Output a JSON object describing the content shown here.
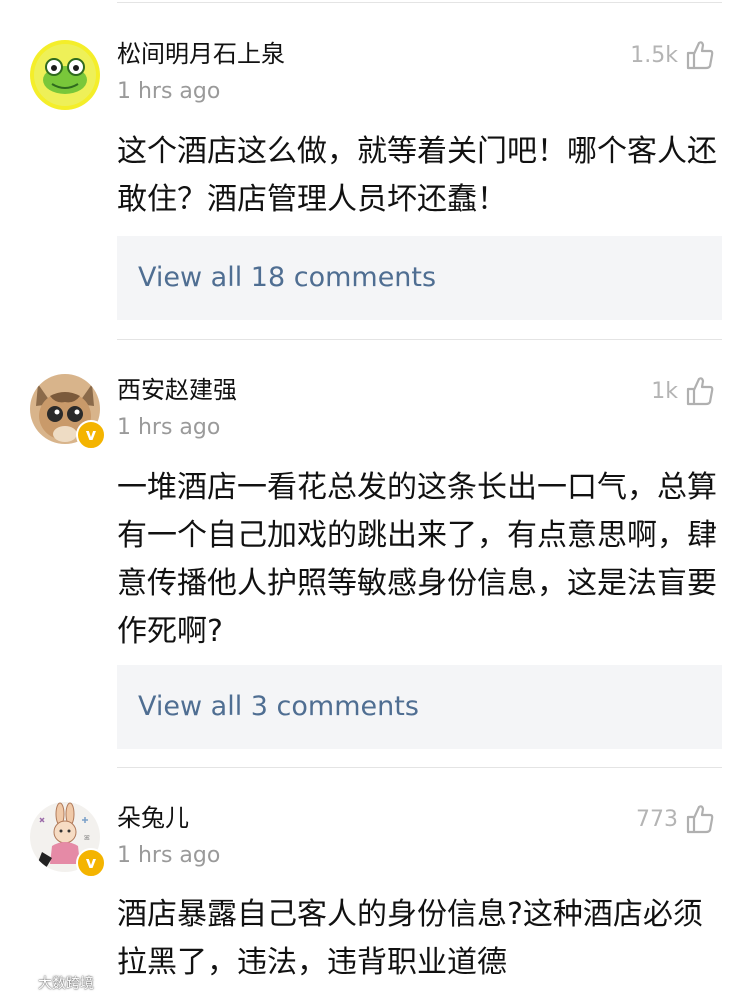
{
  "comments": [
    {
      "username": "松间明月石上泉",
      "time": "1 hrs ago",
      "likes": "1.5k",
      "text": "这个酒店这么做，就等着关门吧！哪个客人还敢住？酒店管理人员坏还蠢！",
      "replies_label": "View all 18 comments",
      "verified": false,
      "avatar": "green-frog-avatar"
    },
    {
      "username": "西安赵建强",
      "time": "1 hrs ago",
      "likes": "1k",
      "text": "一堆酒店一看花总发的这条长出一口气，总算有一个自己加戏的跳出来了，有点意思啊，肆意传播他人护照等敏感身份信息，这是法盲要作死啊?",
      "replies_label": "View all 3 comments",
      "verified": true,
      "avatar": "cat-avatar"
    },
    {
      "username": "朵兔儿",
      "time": "1 hrs ago",
      "likes": "773",
      "text": "酒店暴露自己客人的身份信息?这种酒店必须拉黑了，违法，违背职业道德",
      "verified": true,
      "avatar": "bunny-illustration-avatar"
    }
  ],
  "watermark": {
    "text": "大数跨境",
    "logo": "watermark-logo-icon"
  },
  "colors": {
    "link": "#4f6e92",
    "muted": "#9a9a9a",
    "reply_bg": "#f4f5f7",
    "verified_badge": "#f4b400"
  }
}
